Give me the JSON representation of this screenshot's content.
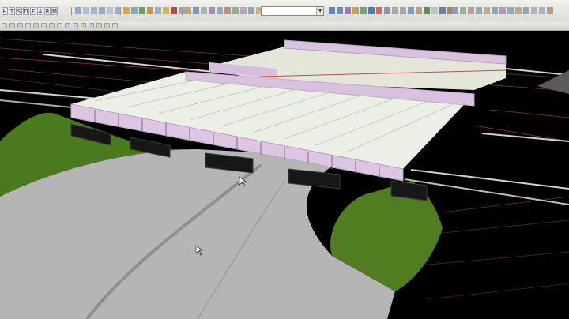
{
  "toolbar": {
    "mode_letters": [
      "H",
      "T",
      "S",
      "D",
      "F",
      "A",
      "R",
      "M"
    ],
    "view_combo_value": ""
  },
  "colors": {
    "background": "#000000",
    "terrain_green": "#4b7a1e",
    "road_gray": "#b7b7b7",
    "deck_white": "#ecefe6",
    "parapet_lilac": "#d9c2df",
    "pier_black": "#171717",
    "alignment_red": "#c23a3a",
    "guardrail_gray": "#d2d2d2"
  },
  "viewport": {
    "scene": "3D bridge overpass model",
    "cursors": [
      "arrow-cursor",
      "arrow-cursor"
    ]
  }
}
